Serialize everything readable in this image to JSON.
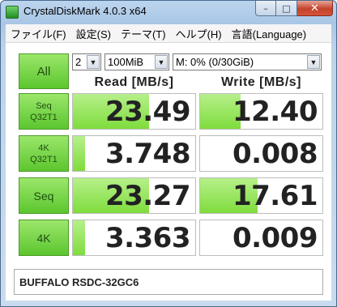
{
  "window": {
    "title": "CrystalDiskMark 4.0.3 x64"
  },
  "caption": {
    "minimize": "–",
    "maximize": "□",
    "close": "✕"
  },
  "menu": {
    "items": [
      "ファイル(F)",
      "設定(S)",
      "テーマ(T)",
      "ヘルプ(H)",
      "言語(Language)"
    ]
  },
  "controls": {
    "all_label": "All",
    "count_value": "2",
    "size_value": "100MiB",
    "drive_value": "M: 0% (0/30GiB)"
  },
  "headers": {
    "read": "Read [MB/s]",
    "write": "Write [MB/s]"
  },
  "rows": [
    {
      "label_line1": "Seq",
      "label_line2": "Q32T1",
      "read": "23.49",
      "write": "12.40",
      "read_bar": 0.62,
      "write_bar": 0.33
    },
    {
      "label_line1": "4K",
      "label_line2": "Q32T1",
      "read": "3.748",
      "write": "0.008",
      "read_bar": 0.1,
      "write_bar": 0.0
    },
    {
      "label_line1": "Seq",
      "label_line2": "",
      "read": "23.27",
      "write": "17.61",
      "read_bar": 0.62,
      "write_bar": 0.47
    },
    {
      "label_line1": "4K",
      "label_line2": "",
      "read": "3.363",
      "write": "0.009",
      "read_bar": 0.1,
      "write_bar": 0.0
    }
  ],
  "comment": "BUFFALO RSDC-32GC6",
  "colors": {
    "button_green": "#5cc62e",
    "bar_green": "#7fdc3d",
    "close_red": "#c4432b"
  }
}
